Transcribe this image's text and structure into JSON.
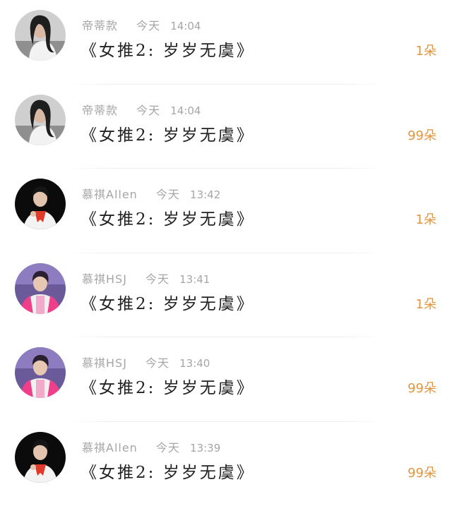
{
  "messages": [
    {
      "user": "帝蒂款",
      "day": "今天",
      "time": "14:04",
      "title": "《女推2: 岁岁无虞》",
      "gift": "1朵",
      "avatar": "avatar-dark-hair-white-top"
    },
    {
      "user": "帝蒂款",
      "day": "今天",
      "time": "14:04",
      "title": "《女推2: 岁岁无虞》",
      "gift": "99朵",
      "avatar": "avatar-dark-hair-white-top"
    },
    {
      "user": "慕祺Allen",
      "day": "今天",
      "time": "13:42",
      "title": "《女推2: 岁岁无虞》",
      "gift": "1朵",
      "avatar": "avatar-red-scarf-stage"
    },
    {
      "user": "慕祺HSJ",
      "day": "今天",
      "time": "13:41",
      "title": "《女推2: 岁岁无虞》",
      "gift": "1朵",
      "avatar": "avatar-pink-jacket-stage"
    },
    {
      "user": "慕祺HSJ",
      "day": "今天",
      "time": "13:40",
      "title": "《女推2: 岁岁无虞》",
      "gift": "99朵",
      "avatar": "avatar-pink-jacket-stage"
    },
    {
      "user": "慕祺Allen",
      "day": "今天",
      "time": "13:39",
      "title": "《女推2: 岁岁无虞》",
      "gift": "99朵",
      "avatar": "avatar-red-scarf-stage"
    }
  ],
  "colors": {
    "gift": "#e2953f",
    "meta": "#a6a6a6",
    "title": "#222222"
  }
}
